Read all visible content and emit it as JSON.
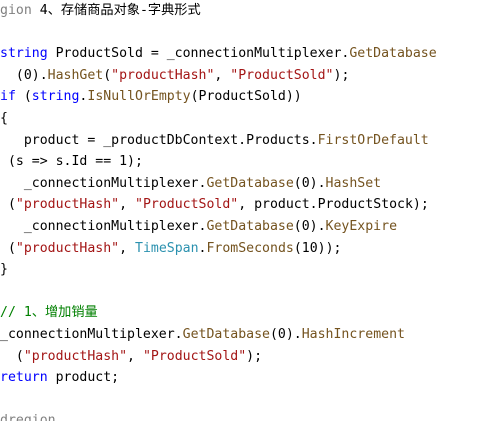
{
  "editor": {
    "lines": [
      [
        {
          "t": "gion ",
          "c": "#808080"
        },
        {
          "t": "4、存储商品对象-字典形式",
          "c": "#000000"
        }
      ],
      [],
      [
        {
          "t": "string",
          "c": "#0000ff"
        },
        {
          "t": " ProductSold = _connectionMultiplexer.",
          "c": "#000000"
        },
        {
          "t": "GetDatabase",
          "c": "#74531f"
        }
      ],
      [
        {
          "t": "  (0).",
          "c": "#000000"
        },
        {
          "t": "HashGet",
          "c": "#74531f"
        },
        {
          "t": "(",
          "c": "#000000"
        },
        {
          "t": "\"productHash\"",
          "c": "#a31515"
        },
        {
          "t": ", ",
          "c": "#000000"
        },
        {
          "t": "\"ProductSold\"",
          "c": "#a31515"
        },
        {
          "t": ");",
          "c": "#000000"
        }
      ],
      [
        {
          "t": "if",
          "c": "#0000ff"
        },
        {
          "t": " (",
          "c": "#000000"
        },
        {
          "t": "string",
          "c": "#0000ff"
        },
        {
          "t": ".",
          "c": "#000000"
        },
        {
          "t": "IsNullOrEmpty",
          "c": "#74531f"
        },
        {
          "t": "(ProductSold))",
          "c": "#000000"
        }
      ],
      [
        {
          "t": "{",
          "c": "#000000"
        }
      ],
      [
        {
          "t": "   product = _productDbContext.Products.",
          "c": "#000000"
        },
        {
          "t": "FirstOrDefault",
          "c": "#74531f"
        }
      ],
      [
        {
          "t": " (s => s.Id == 1);",
          "c": "#000000"
        }
      ],
      [
        {
          "t": "   _connectionMultiplexer.",
          "c": "#000000"
        },
        {
          "t": "GetDatabase",
          "c": "#74531f"
        },
        {
          "t": "(0).",
          "c": "#000000"
        },
        {
          "t": "HashSet",
          "c": "#74531f"
        }
      ],
      [
        {
          "t": " (",
          "c": "#000000"
        },
        {
          "t": "\"productHash\"",
          "c": "#a31515"
        },
        {
          "t": ", ",
          "c": "#000000"
        },
        {
          "t": "\"ProductSold\"",
          "c": "#a31515"
        },
        {
          "t": ", product.ProductStock);",
          "c": "#000000"
        }
      ],
      [
        {
          "t": "   _connectionMultiplexer.",
          "c": "#000000"
        },
        {
          "t": "GetDatabase",
          "c": "#74531f"
        },
        {
          "t": "(0).",
          "c": "#000000"
        },
        {
          "t": "KeyExpire",
          "c": "#74531f"
        }
      ],
      [
        {
          "t": " (",
          "c": "#000000"
        },
        {
          "t": "\"productHash\"",
          "c": "#a31515"
        },
        {
          "t": ", ",
          "c": "#000000"
        },
        {
          "t": "TimeSpan",
          "c": "#2b91af"
        },
        {
          "t": ".",
          "c": "#000000"
        },
        {
          "t": "FromSeconds",
          "c": "#74531f"
        },
        {
          "t": "(10));",
          "c": "#000000"
        }
      ],
      [
        {
          "t": "}",
          "c": "#000000"
        }
      ],
      [],
      [
        {
          "t": "// 1、增加销量",
          "c": "#008000"
        }
      ],
      [
        {
          "t": "_connectionMultiplexer.",
          "c": "#000000"
        },
        {
          "t": "GetDatabase",
          "c": "#74531f"
        },
        {
          "t": "(0).",
          "c": "#000000"
        },
        {
          "t": "HashIncrement",
          "c": "#74531f"
        }
      ],
      [
        {
          "t": "  (",
          "c": "#000000"
        },
        {
          "t": "\"productHash\"",
          "c": "#a31515"
        },
        {
          "t": ", ",
          "c": "#000000"
        },
        {
          "t": "\"ProductSold\"",
          "c": "#a31515"
        },
        {
          "t": ");",
          "c": "#000000"
        }
      ],
      [
        {
          "t": "return",
          "c": "#0000ff"
        },
        {
          "t": " product;",
          "c": "#000000"
        }
      ],
      [],
      [
        {
          "t": "dregion",
          "c": "#808080"
        }
      ]
    ]
  }
}
